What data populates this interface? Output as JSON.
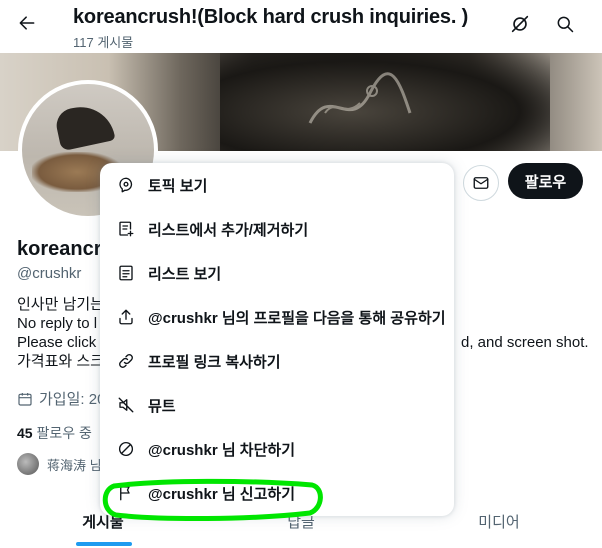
{
  "header": {
    "title": "koreancrush!(Block hard crush inquiries. )",
    "post_count": "117 게시물",
    "back_icon": "back-arrow-icon",
    "icons": [
      "grok-icon",
      "search-icon"
    ]
  },
  "profile": {
    "name": "koreancr",
    "handle": "@crushkr",
    "bio_lines": [
      "인사만 남기는",
      "No reply to l",
      "Please click",
      "가격표와 스크"
    ],
    "bio_right_fragment": "d, and screen shot.",
    "joined": "가입일: 20",
    "following_count": "45",
    "following_label": "팔로우 중",
    "followed_by_text": "蒋海涛 님"
  },
  "actions": {
    "follow_label": "팔로우",
    "message_icon": "envelope-icon"
  },
  "menu": {
    "items": [
      {
        "label": "토픽 보기",
        "icon": "topic-icon"
      },
      {
        "label": "리스트에서 추가/제거하기",
        "icon": "list-add-icon"
      },
      {
        "label": "리스트 보기",
        "icon": "list-icon"
      },
      {
        "label": "@crushkr 님의 프로필을 다음을 통해 공유하기",
        "icon": "share-icon"
      },
      {
        "label": "프로필 링크 복사하기",
        "icon": "link-icon"
      },
      {
        "label": "뮤트",
        "icon": "mute-icon"
      },
      {
        "label": "@crushkr 님 차단하기",
        "icon": "block-icon"
      },
      {
        "label": "@crushkr 님 신고하기",
        "icon": "flag-icon"
      }
    ]
  },
  "tabs": [
    {
      "label": "게시물",
      "active": true
    },
    {
      "label": "답글",
      "active": false
    },
    {
      "label": "미디어",
      "active": false
    }
  ],
  "colors": {
    "accent": "#1d9bf0",
    "highlight": "#00e600",
    "text": "#0f1419",
    "muted": "#536471"
  }
}
